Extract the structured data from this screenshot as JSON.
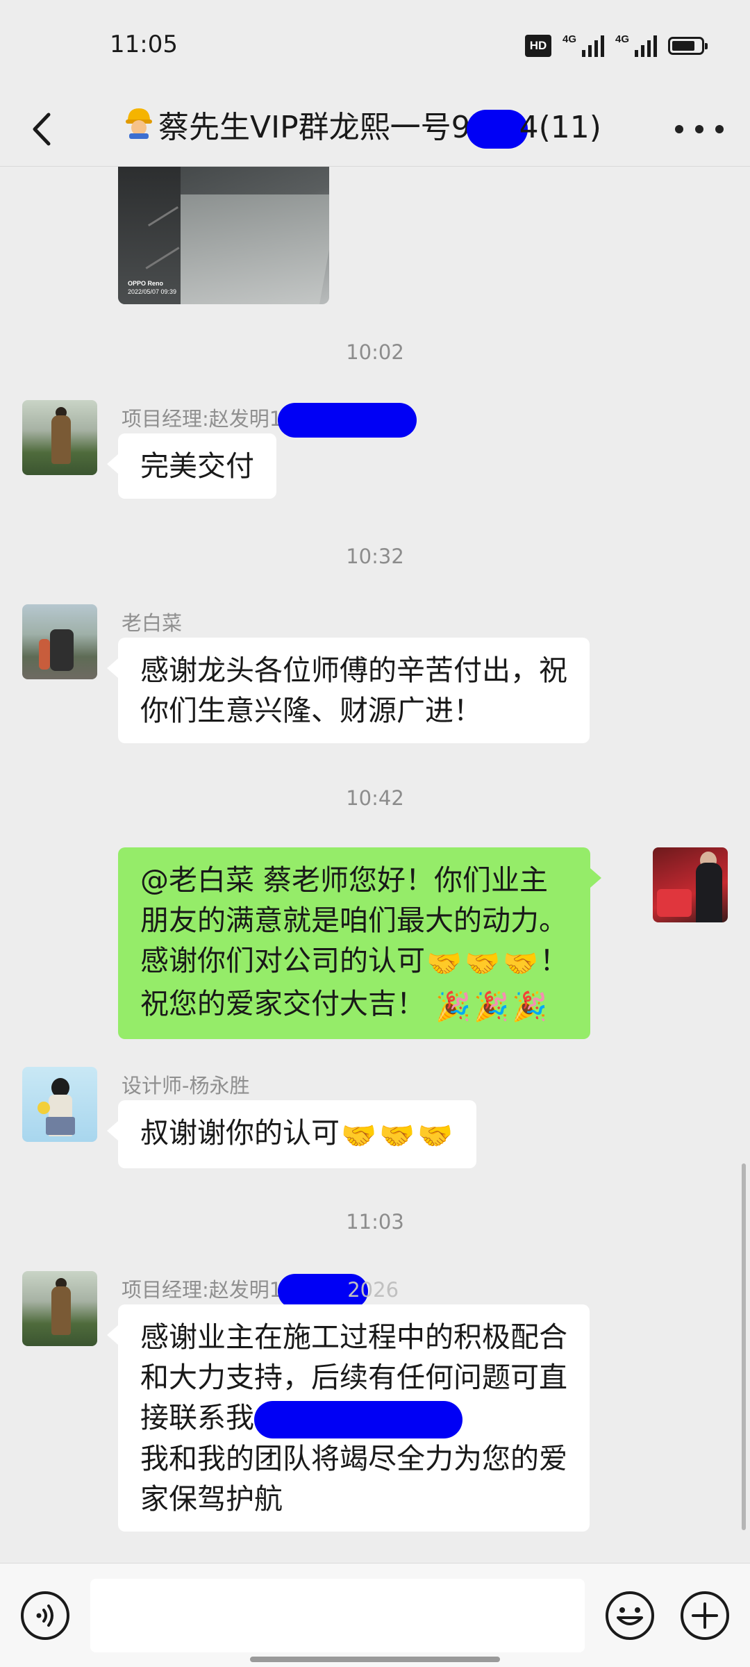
{
  "status_bar": {
    "time": "11:05",
    "hd_label": "HD",
    "network_1": "4G",
    "network_2": "4G",
    "battery_level": 0.8
  },
  "header": {
    "back_icon": "chevron-left-icon",
    "title_emoji": "construction-worker-emoji",
    "title_prefix": "蔡先生VIP群龙熙一号9",
    "title_suffix": "4(11)",
    "more_icon": "ellipsis-icon"
  },
  "photo_message": {
    "watermark_brand": "OPPO Reno",
    "watermark_date": "2022/05/07 09:39"
  },
  "messages": [
    {
      "type": "time",
      "text": "10:02"
    },
    {
      "type": "incoming",
      "sender": "项目经理:赵发明1",
      "avatar": "person-outdoor-avatar",
      "lines": [
        "完美交付"
      ]
    },
    {
      "type": "time",
      "text": "10:32"
    },
    {
      "type": "incoming",
      "sender": "老白菜",
      "avatar": "couple-outdoor-avatar",
      "lines": [
        "感谢龙头各位师傅的辛苦付出，祝",
        "你们生意兴隆、财源广进！"
      ]
    },
    {
      "type": "time",
      "text": "10:42"
    },
    {
      "type": "outgoing",
      "avatar": "man-red-seats-avatar",
      "lines": [
        "@老白菜  蔡老师您好！你们业主",
        "朋友的满意就是咱们最大的动力。",
        "感谢你们对公司的认可",
        "！",
        "祝您的爱家交付大吉！"
      ]
    },
    {
      "type": "incoming",
      "sender": "设计师-杨永胜",
      "avatar": "girl-flower-avatar",
      "lines": [
        "叔谢谢你的认可"
      ]
    },
    {
      "type": "time",
      "text": "11:03"
    },
    {
      "type": "incoming",
      "sender": "项目经理:赵发明1",
      "sender_tail": "2026",
      "avatar": "person-outdoor-avatar",
      "lines": [
        "感谢业主在施工过程中的积极配合",
        "和大力支持，后续有任何问题可直",
        "接联系我:",
        "我和我的团队将竭尽全力为您的爱",
        "家保驾护航"
      ]
    }
  ],
  "emojis": {
    "handshake": "🤝",
    "party_popper": "🎉"
  },
  "input_bar": {
    "voice_icon": "voice-input-icon",
    "emoji_icon": "smiley-face-icon",
    "plus_icon": "plus-circle-icon",
    "text_value": ""
  }
}
